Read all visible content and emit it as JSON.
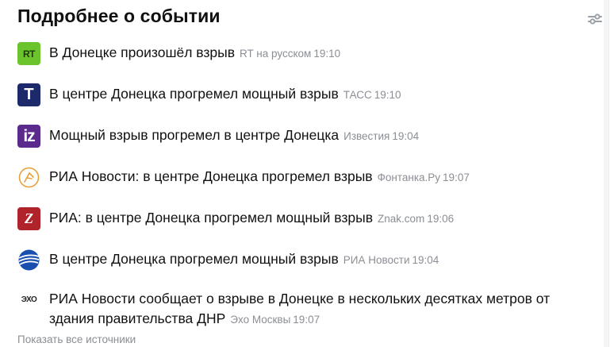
{
  "header": {
    "title": "Подробнее о событии"
  },
  "items": [
    {
      "headline": "В Донецке произошёл взрыв",
      "source": "RT на русском",
      "time": "19:10",
      "logo": "rt-logo",
      "logo_text": "RT",
      "logo_color": "#6bc42b"
    },
    {
      "headline": "В центре Донецка прогремел мощный взрыв",
      "source": "ТАСС",
      "time": "19:10",
      "logo": "tass-logo",
      "logo_text": "Т",
      "logo_color": "#1c2a6b"
    },
    {
      "headline": "Мощный взрыв прогремел в центре Донецка",
      "source": "Известия",
      "time": "19:04",
      "logo": "izvestia-logo",
      "logo_text": "iz",
      "logo_color": "#5a2a8c"
    },
    {
      "headline": "РИА Новости: в центре Донецка прогремел взрыв",
      "source": "Фонтанка.Ру",
      "time": "19:07",
      "logo": "fontanka-logo",
      "logo_text": "",
      "logo_color": "#e8a13a"
    },
    {
      "headline": "РИА: в центре Донецка прогремел мощный взрыв",
      "source": "Znak.com",
      "time": "19:06",
      "logo": "znak-logo",
      "logo_text": "Z",
      "logo_color": "#b0232a"
    },
    {
      "headline": "В центре Донецка прогремел мощный взрыв",
      "source": "РИА Новости",
      "time": "19:04",
      "logo": "ria-logo",
      "logo_text": "",
      "logo_color": "#1a4fb0"
    },
    {
      "headline": "РИА Новости сообщает о взрыве в Донецке в нескольких десятках метров от здания правительства ДНР",
      "source": "Эхо Москвы",
      "time": "19:07",
      "logo": "echo-logo",
      "logo_text": "ЭХО",
      "logo_color": "#222222"
    }
  ],
  "footer": {
    "show_all_label": "Показать все источники"
  }
}
